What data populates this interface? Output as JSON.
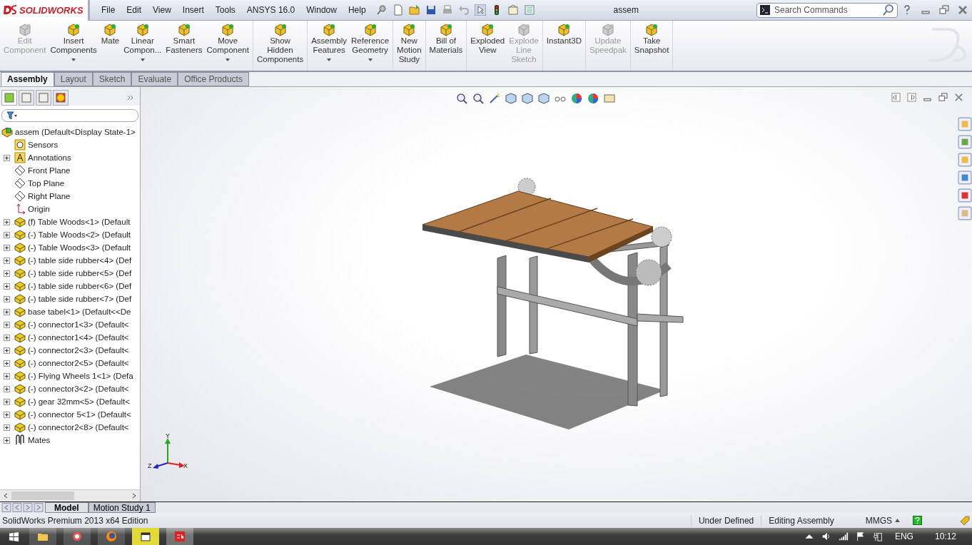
{
  "app": {
    "logo": "SOLIDWORKS",
    "document_title": "assem"
  },
  "menu": [
    "File",
    "Edit",
    "View",
    "Insert",
    "Tools",
    "ANSYS 16.0",
    "Window",
    "Help"
  ],
  "search": {
    "placeholder": "Search Commands"
  },
  "command_groups": [
    {
      "buttons": [
        {
          "label": "Edit\nComponent",
          "disabled": true,
          "dropdown": false
        },
        {
          "label": "Insert\nComponents",
          "disabled": false,
          "dropdown": true
        },
        {
          "label": "Mate",
          "disabled": false,
          "dropdown": false
        },
        {
          "label": "Linear\nCompon...",
          "disabled": false,
          "dropdown": true
        },
        {
          "label": "Smart\nFasteners",
          "disabled": false,
          "dropdown": false
        },
        {
          "label": "Move\nComponent",
          "disabled": false,
          "dropdown": true
        }
      ]
    },
    {
      "buttons": [
        {
          "label": "Show\nHidden\nComponents",
          "disabled": false,
          "dropdown": false
        }
      ]
    },
    {
      "buttons": [
        {
          "label": "Assembly\nFeatures",
          "disabled": false,
          "dropdown": true
        },
        {
          "label": "Reference\nGeometry",
          "disabled": false,
          "dropdown": true
        }
      ]
    },
    {
      "buttons": [
        {
          "label": "New\nMotion\nStudy",
          "disabled": false,
          "dropdown": false
        }
      ]
    },
    {
      "buttons": [
        {
          "label": "Bill of\nMaterials",
          "disabled": false,
          "dropdown": false
        }
      ]
    },
    {
      "buttons": [
        {
          "label": "Exploded\nView",
          "disabled": false,
          "dropdown": false
        },
        {
          "label": "Explode\nLine\nSketch",
          "disabled": true,
          "dropdown": false
        }
      ]
    },
    {
      "buttons": [
        {
          "label": "Instant3D",
          "disabled": false,
          "dropdown": false
        }
      ]
    },
    {
      "buttons": [
        {
          "label": "Update\nSpeedpak",
          "disabled": true,
          "dropdown": false
        }
      ]
    },
    {
      "buttons": [
        {
          "label": "Take\nSnapshot",
          "disabled": false,
          "dropdown": false
        }
      ]
    }
  ],
  "tabs": [
    {
      "label": "Assembly",
      "selected": true
    },
    {
      "label": "Layout",
      "selected": false
    },
    {
      "label": "Sketch",
      "selected": false
    },
    {
      "label": "Evaluate",
      "selected": false
    },
    {
      "label": "Office Products",
      "selected": false
    }
  ],
  "feature_tree": {
    "root": {
      "label": "assem  (Default<Display State-1>",
      "children": [
        {
          "label": "Sensors",
          "kind": "sensors",
          "expandable": false
        },
        {
          "label": "Annotations",
          "kind": "annotations",
          "expandable": true
        },
        {
          "label": "Front Plane",
          "kind": "plane",
          "expandable": false
        },
        {
          "label": "Top Plane",
          "kind": "plane",
          "expandable": false
        },
        {
          "label": "Right Plane",
          "kind": "plane",
          "expandable": false
        },
        {
          "label": "Origin",
          "kind": "origin",
          "expandable": false
        },
        {
          "label": "(f) Table Woods<1> (Default",
          "kind": "part",
          "expandable": true
        },
        {
          "label": "(-) Table Woods<2> (Default",
          "kind": "part",
          "expandable": true
        },
        {
          "label": "(-) Table Woods<3> (Default",
          "kind": "part",
          "expandable": true
        },
        {
          "label": "(-) table side rubber<4> (Def",
          "kind": "part",
          "expandable": true
        },
        {
          "label": "(-) table side rubber<5> (Def",
          "kind": "part",
          "expandable": true
        },
        {
          "label": "(-) table side rubber<6> (Def",
          "kind": "part",
          "expandable": true
        },
        {
          "label": "(-) table side rubber<7> (Def",
          "kind": "part",
          "expandable": true
        },
        {
          "label": "base tabel<1> (Default<<De",
          "kind": "part",
          "expandable": true
        },
        {
          "label": "(-) connector1<3> (Default<",
          "kind": "part",
          "expandable": true
        },
        {
          "label": "(-) connector1<4> (Default<",
          "kind": "part",
          "expandable": true
        },
        {
          "label": "(-) connector2<3> (Default<",
          "kind": "part",
          "expandable": true
        },
        {
          "label": "(-) connector2<5> (Default<",
          "kind": "part",
          "expandable": true
        },
        {
          "label": "(-) Flying Wheels 1<1> (Defa",
          "kind": "part",
          "expandable": true
        },
        {
          "label": "(-) connector3<2> (Default<",
          "kind": "part",
          "expandable": true
        },
        {
          "label": "(-) gear 32mm<5> (Default<",
          "kind": "part",
          "expandable": true
        },
        {
          "label": "(-) connector 5<1> (Default<",
          "kind": "part",
          "expandable": true
        },
        {
          "label": "(-) connector2<8> (Default<",
          "kind": "part",
          "expandable": true
        },
        {
          "label": "Mates",
          "kind": "mates",
          "expandable": true
        }
      ]
    }
  },
  "triad": {
    "x": "X",
    "y": "Y",
    "z": "Z"
  },
  "bottom_tabs": [
    {
      "label": "Model",
      "selected": true
    },
    {
      "label": "Motion Study 1",
      "selected": false
    }
  ],
  "status_bar": {
    "product": "SolidWorks Premium 2013 x64 Edition",
    "state": "Under Defined",
    "mode": "Editing Assembly",
    "units": "MMGS"
  },
  "taskbar": {
    "language": "ENG",
    "time": "10:12"
  }
}
